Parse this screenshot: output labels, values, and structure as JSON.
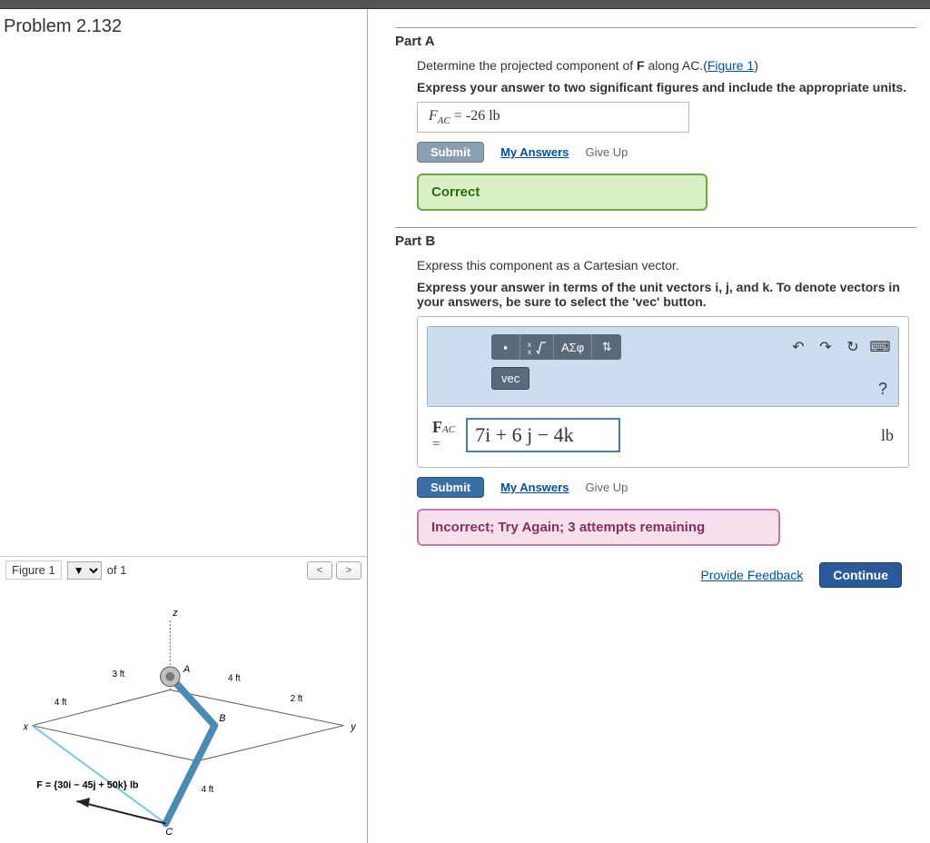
{
  "problem_title": "Problem 2.132",
  "figure": {
    "label": "Figure 1",
    "of_text": "of 1",
    "prev": "<",
    "next": ">",
    "force_label": "F = {30i − 45j + 50k} lb",
    "dims": {
      "a": "3 ft",
      "b": "4 ft",
      "c": "4 ft",
      "d": "2 ft",
      "e": "4 ft"
    }
  },
  "partA": {
    "heading": "Part A",
    "instruction_prefix": "Determine the projected component of ",
    "instruction_bold": "F",
    "instruction_mid": " along AC.(",
    "figure_link": "Figure 1",
    "instruction_suffix": ")",
    "requirements": "Express your answer to two significant figures and include the appropriate units.",
    "answer_var": "F",
    "answer_sub": "AC",
    "answer_value": "-26 lb",
    "submit": "Submit",
    "my_answers": "My Answers",
    "give_up": "Give Up",
    "feedback": "Correct"
  },
  "partB": {
    "heading": "Part B",
    "instruction": "Express this component as a Cartesian vector.",
    "requirements": "Express your answer in terms of the unit vectors i, j, and k. To denote vectors in your answers, be sure to select the 'vec' button.",
    "toolbar": {
      "greek": "ΑΣφ",
      "vec": "vec",
      "undo": "↶",
      "redo": "↷",
      "reset": "↻",
      "keyboard": "⌨",
      "help": "?"
    },
    "answer_var": "F",
    "answer_sub": "AC",
    "answer_value": "7i + 6 j  − 4k",
    "unit": "lb",
    "submit": "Submit",
    "my_answers": "My Answers",
    "give_up": "Give Up",
    "feedback": "Incorrect; Try Again; 3 attempts remaining"
  },
  "footer": {
    "provide_feedback": "Provide Feedback",
    "continue": "Continue"
  }
}
